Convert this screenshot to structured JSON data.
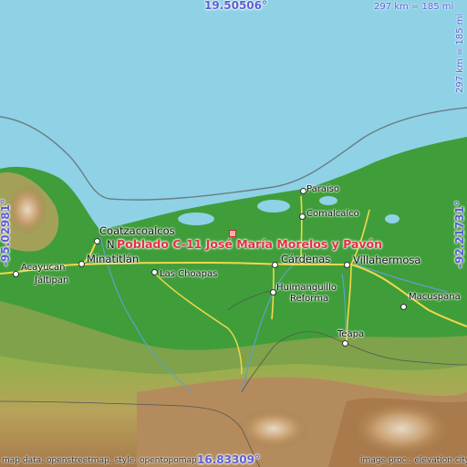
{
  "coordinates": {
    "top_lat": "19.50506°",
    "bottom_lat": "16.83309°",
    "left_lon": "-95.02981°",
    "right_lon": "-92.21731°"
  },
  "scale": {
    "horizontal": "297 km = 185 mi",
    "vertical": "297 km = 185 mi"
  },
  "place": {
    "name": "Poblado C-11 José María Morelos y Pavón"
  },
  "cities": [
    {
      "name": "Coatzacoalcos"
    },
    {
      "name": "N"
    },
    {
      "name": "Minatitlán"
    },
    {
      "name": "Acayucan"
    },
    {
      "name": "Jáltipan"
    },
    {
      "name": "Las Choapas"
    },
    {
      "name": "Paraíso"
    },
    {
      "name": "Comalcalco"
    },
    {
      "name": "Cárdenas"
    },
    {
      "name": "Villahermosa"
    },
    {
      "name": "Huimanguillo"
    },
    {
      "name": "Reforma"
    },
    {
      "name": "Macuspana"
    },
    {
      "name": "Teapa"
    }
  ],
  "attribution": {
    "left": "map data: openstreetmap, style: opentopomap",
    "right": "image proc.: elevation.city"
  },
  "colors": {
    "sea": "#8fd2e6",
    "lowland": "#3f9e3a",
    "highland": "#b08a5a",
    "marker": "#d0242f"
  }
}
